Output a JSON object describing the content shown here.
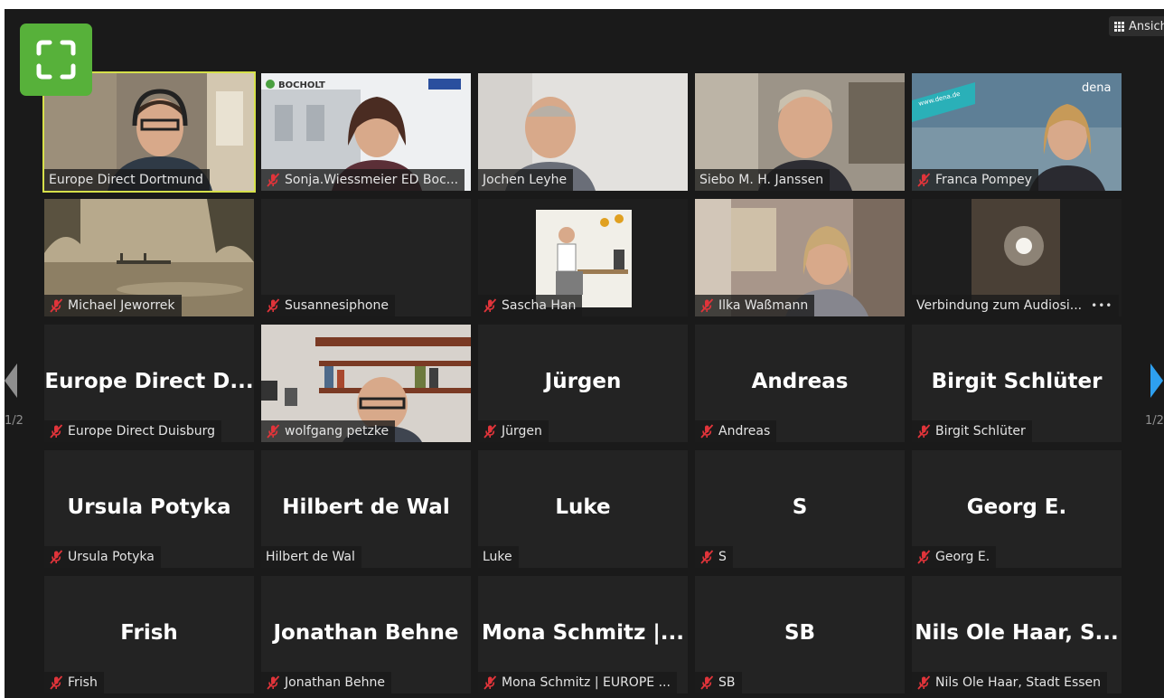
{
  "toolbar": {
    "view_label": "Ansicht"
  },
  "pagination": {
    "left_label": "1/2",
    "right_label": "1/2"
  },
  "colors": {
    "active_speaker": "#d6e04a",
    "fullscreen_button": "#57b13a",
    "next_arrow": "#2ea0f0",
    "muted_mic": "#e0343a"
  },
  "participants": [
    {
      "label": "Europe Direct Dortmund",
      "muted": false,
      "active": true,
      "video": "man-headset-office"
    },
    {
      "label": "Sonja.Wiessmeier ED Boc...",
      "muted": true,
      "video": "woman-bocholt-backdrop",
      "backdrop_text": "BOCHOLT"
    },
    {
      "label": "Jochen Leyhe",
      "muted": false,
      "video": "man-plain-wall"
    },
    {
      "label": "Siebo M. H. Janssen",
      "muted": false,
      "video": "man-home-room"
    },
    {
      "label": "Franca Pompey",
      "muted": true,
      "video": "woman-dena-backdrop",
      "backdrop_text": "dena",
      "backdrop_url": "www.dena.de"
    },
    {
      "label": "Michael Jeworrek",
      "muted": true,
      "video": "misty-lake-image"
    },
    {
      "label": "Susannesiphone",
      "muted": true,
      "video": "none"
    },
    {
      "label": "Sascha Han",
      "muted": true,
      "video": "desk-illustration"
    },
    {
      "label": "Ilka Waßmann",
      "muted": true,
      "video": "woman-living-room"
    },
    {
      "label": "Verbindung zum Audiosi...",
      "muted": false,
      "more": "•••",
      "video": "dark-room-light"
    },
    {
      "big": "Europe Direct D...",
      "label": "Europe Direct Duisburg",
      "muted": true
    },
    {
      "label": "wolfgang petzke",
      "muted": true,
      "video": "man-bookshelf"
    },
    {
      "big": "Jürgen",
      "label": "Jürgen",
      "muted": true
    },
    {
      "big": "Andreas",
      "label": "Andreas",
      "muted": true
    },
    {
      "big": "Birgit Schlüter",
      "label": "Birgit Schlüter",
      "muted": true
    },
    {
      "big": "Ursula Potyka",
      "label": "Ursula Potyka",
      "muted": true
    },
    {
      "big": "Hilbert de Wal",
      "label": "Hilbert de Wal",
      "muted": false
    },
    {
      "big": "Luke",
      "label": "Luke",
      "muted": false
    },
    {
      "big": "S",
      "label": "S",
      "muted": true
    },
    {
      "big": "Georg E.",
      "label": "Georg E.",
      "muted": true
    },
    {
      "big": "Frish",
      "label": "Frish",
      "muted": true
    },
    {
      "big": "Jonathan Behne",
      "label": "Jonathan Behne",
      "muted": true
    },
    {
      "big": "Mona Schmitz |...",
      "label": "Mona Schmitz | EUROPE ...",
      "muted": true
    },
    {
      "big": "SB",
      "label": "SB",
      "muted": true
    },
    {
      "big": "Nils Ole Haar, S...",
      "label": "Nils Ole Haar, Stadt Essen",
      "muted": true
    }
  ]
}
